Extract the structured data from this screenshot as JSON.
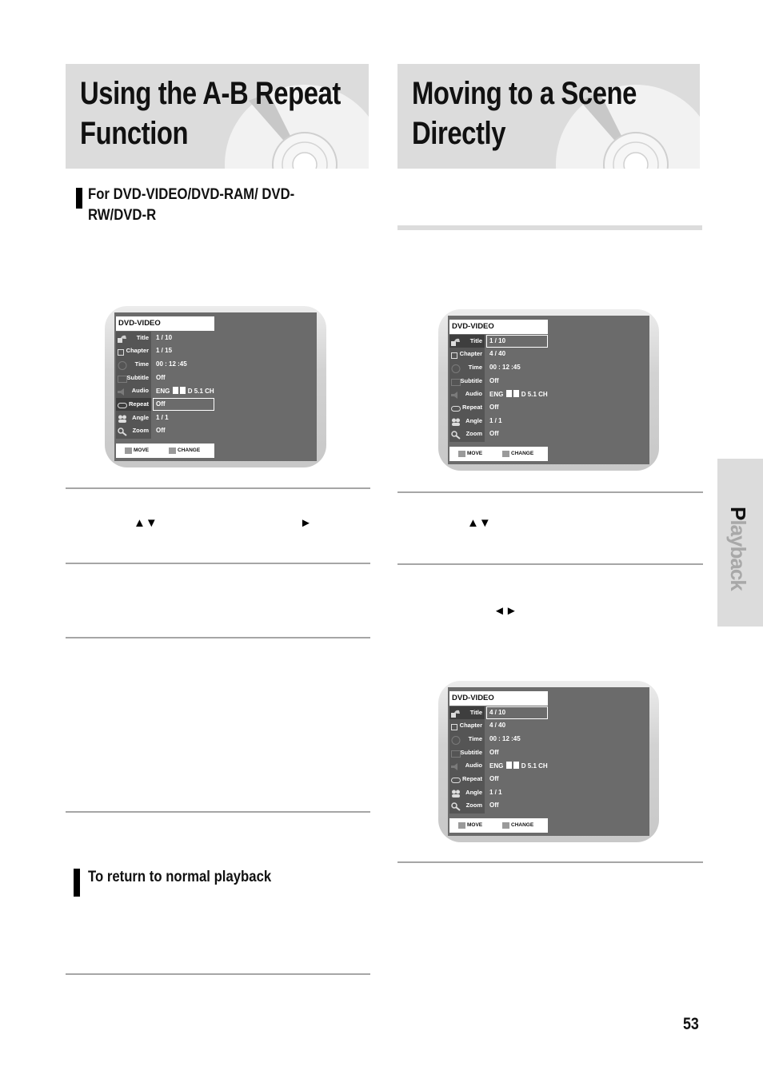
{
  "left": {
    "title_line1": "Using the A-B Repeat",
    "title_line2": "Function",
    "subheading_line1": "For DVD-VIDEO/DVD-RAM/ DVD-",
    "subheading_line2": "RW/DVD-R",
    "step_glyphs": {
      "up_down": "▲▼",
      "play": "►"
    },
    "return_heading": "To return to normal playback"
  },
  "right": {
    "title_line1": "Moving to a Scene",
    "title_line2": "Directly",
    "step_glyphs": {
      "up_down": "▲▼",
      "left_right": "◄►"
    }
  },
  "osd_labels": {
    "header": "DVD-VIDEO",
    "rows": [
      "Title",
      "Chapter",
      "Time",
      "Subtitle",
      "Audio",
      "Repeat",
      "Angle",
      "Zoom"
    ],
    "footer_move": "MOVE",
    "footer_change": "CHANGE"
  },
  "osd_screens": [
    {
      "values": [
        "1 / 10",
        "1 / 15",
        "00 : 12 :45",
        "Off",
        "ENG",
        "Off",
        "1 / 1",
        "Off"
      ],
      "audio_suffix": "D 5.1 CH",
      "selected_row": "Repeat"
    },
    {
      "values": [
        "1 / 10",
        "4 / 40",
        "00 : 12 :45",
        "Off",
        "ENG",
        "Off",
        "1 / 1",
        "Off"
      ],
      "audio_suffix": "D 5.1 CH",
      "selected_row": "Title"
    },
    {
      "values": [
        "4 / 10",
        "4 / 40",
        "00 : 12 :45",
        "Off",
        "ENG",
        "Off",
        "1 / 1",
        "Off"
      ],
      "audio_suffix": "D 5.1 CH",
      "selected_row": "Title"
    }
  ],
  "side_tab": {
    "first_letter": "P",
    "rest": "layback"
  },
  "page_number": "53"
}
